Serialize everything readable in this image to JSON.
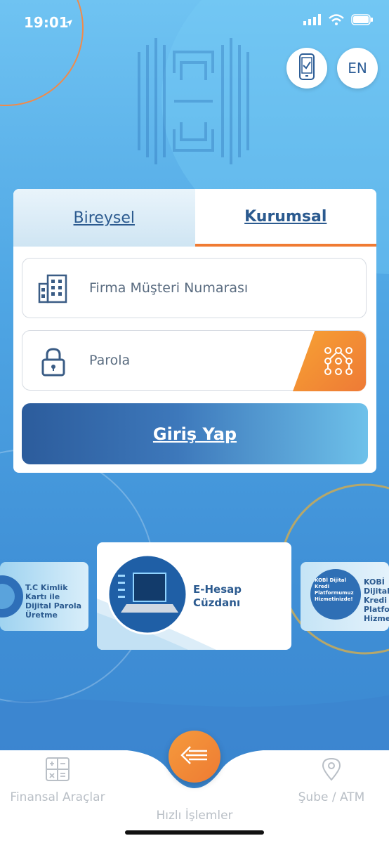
{
  "status_bar": {
    "time": "19:01"
  },
  "header": {
    "language_label": "EN"
  },
  "login": {
    "tabs": [
      {
        "label": "Bireysel"
      },
      {
        "label": "Kurumsal"
      }
    ],
    "customer_number_placeholder": "Firma Müşteri Numarası",
    "password_placeholder": "Parola",
    "submit_label": "Giriş Yap"
  },
  "promos": {
    "left_title": "T.C Kimlik Kartı ile Dijital Parola Üretme",
    "center_title": "E-Hesap Cüzdanı",
    "right_title": "KOBİ Dijital Kredi Platformu Hizmeti",
    "right_image_text": "KOBİ Dijital Kredi Platformumuz Hizmetinizde!"
  },
  "bottom_nav": {
    "items": [
      {
        "label": "Finansal Araçlar",
        "icon": "calculator-icon"
      },
      {
        "label": "Hızlı İşlemler",
        "icon": "quick-actions-icon"
      },
      {
        "label": "Şube / ATM",
        "icon": "location-pin-icon"
      }
    ]
  },
  "colors": {
    "accent": "#f07b33",
    "primary": "#2b5a8f",
    "background": "#4fa6e4"
  }
}
